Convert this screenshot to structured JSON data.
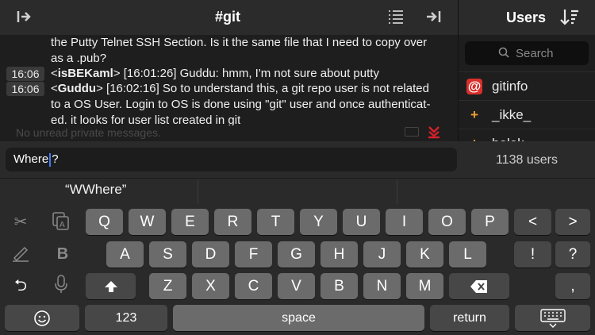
{
  "header": {
    "channel": "#git",
    "users_title": "Users",
    "left_icon": "panel-expand-icon",
    "list_icon": "list-icon",
    "right_icon": "panel-collapse-icon",
    "sort_icon": "sort-descending-icon"
  },
  "chat": {
    "lines": [
      {
        "text": "the Putty Telnet SSH Section. Is it the same file that I need to copy over"
      },
      {
        "text": "as a .pub?"
      },
      {
        "ts": "16:06",
        "open": "<",
        "nick": "isBEKaml",
        "close": ">",
        "text": " [16:01:26] Guddu: hmm, I'm not sure about putty"
      },
      {
        "ts": "16:06",
        "open": "<",
        "nick": "Guddu",
        "close": ">",
        "text": " [16:02:16] So to understand this, a git repo user is not related"
      },
      {
        "text": "to a OS User. Login to OS is done using \"git\" user and once authenticat-"
      },
      {
        "text": "ed. it looks for user list created in git"
      }
    ],
    "unread": "No unread private messages."
  },
  "users": {
    "search_placeholder": "Search",
    "list": [
      {
        "badge": "@",
        "name": "gitinfo",
        "badge_color": "#d9302b",
        "badge_bg": "#d9302b"
      },
      {
        "badge": "+",
        "name": "_ikke_",
        "badge_color": "#f0a030",
        "badge_bg": "transparent"
      },
      {
        "badge": "+",
        "name": "bolok",
        "badge_color": "#f0a030",
        "badge_bg": "transparent"
      }
    ],
    "count": "1138 users"
  },
  "input": {
    "before_caret": "Where",
    "after_caret": "?"
  },
  "suggestions": [
    "“WWhere”",
    "",
    ""
  ],
  "keyboard": {
    "row1": [
      "Q",
      "W",
      "E",
      "R",
      "T",
      "Y",
      "U",
      "I",
      "O",
      "P",
      "<",
      ">"
    ],
    "row2": [
      "A",
      "S",
      "D",
      "F",
      "G",
      "H",
      "J",
      "K",
      "L",
      "!",
      "?"
    ],
    "row3": [
      "Z",
      "X",
      "C",
      "V",
      "B",
      "N",
      "M",
      ","
    ],
    "bold_label": "B",
    "num_label": "123",
    "space_label": "space",
    "return_label": "return"
  },
  "colors": {
    "accent_red": "#d8202a",
    "caret_blue": "#3d7bf6"
  }
}
